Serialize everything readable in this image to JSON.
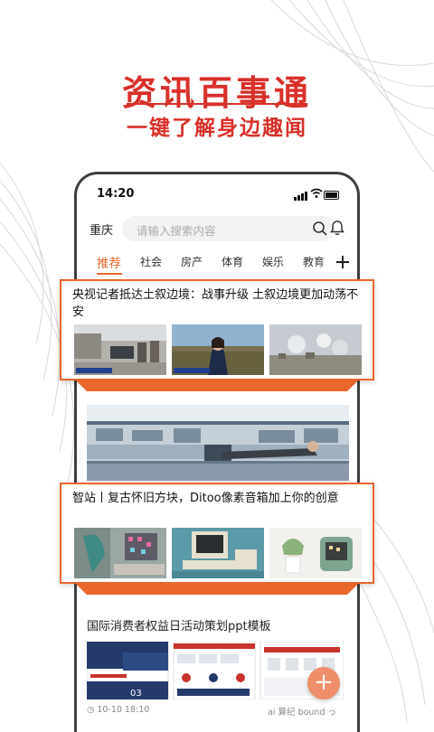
{
  "promo": {
    "title": "资讯百事通",
    "subtitle": "一键了解身边趣闻"
  },
  "status_bar": {
    "time": "14:20"
  },
  "search": {
    "city": "重庆",
    "placeholder": "请输入搜索内容"
  },
  "tabs": [
    {
      "label": "推荐",
      "active": true
    },
    {
      "label": "社会"
    },
    {
      "label": "房产"
    },
    {
      "label": "体育"
    },
    {
      "label": "娱乐"
    },
    {
      "label": "教育"
    }
  ],
  "add_tab_glyph": "+",
  "articles": [
    {
      "title": "央视记者抵达土叙边境：战事升级 土叙边境更加动荡不安"
    },
    {
      "title": "智站丨复古怀旧方块，Ditoo像素音箱加上你的创意"
    },
    {
      "title": "国际消费者权益日活动策划ppt模板",
      "date": "10-10 18:10",
      "source": "ai 算纪 bound っ"
    }
  ],
  "fab_glyph": "+",
  "colors": {
    "accent": "#e9662c",
    "promo_red": "#d9302a",
    "fab": "#ee8f6a"
  }
}
